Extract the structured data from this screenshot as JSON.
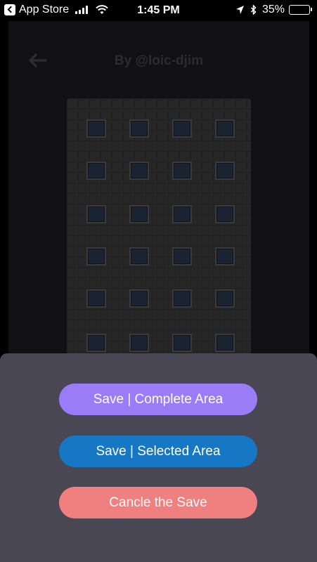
{
  "status_bar": {
    "back_app_label": "App Store",
    "time": "1:45 PM",
    "battery_percent": "35%",
    "battery_level": 0.35,
    "icons": [
      "back-app-icon",
      "signal-icon",
      "wifi-icon",
      "location-icon",
      "bluetooth-icon",
      "battery-icon"
    ]
  },
  "header": {
    "title": "By @loic-djim",
    "back_icon": "back-arrow-icon"
  },
  "sheet": {
    "save_complete_label": "Save | Complete Area",
    "save_selected_label": "Save | Selected Area",
    "cancel_label": "Cancle the Save"
  },
  "colors": {
    "sheet_bg": "#4a4755",
    "complete_btn": "#9b7cf7",
    "selected_btn": "#1677c4",
    "cancel_btn": "#f08080"
  }
}
